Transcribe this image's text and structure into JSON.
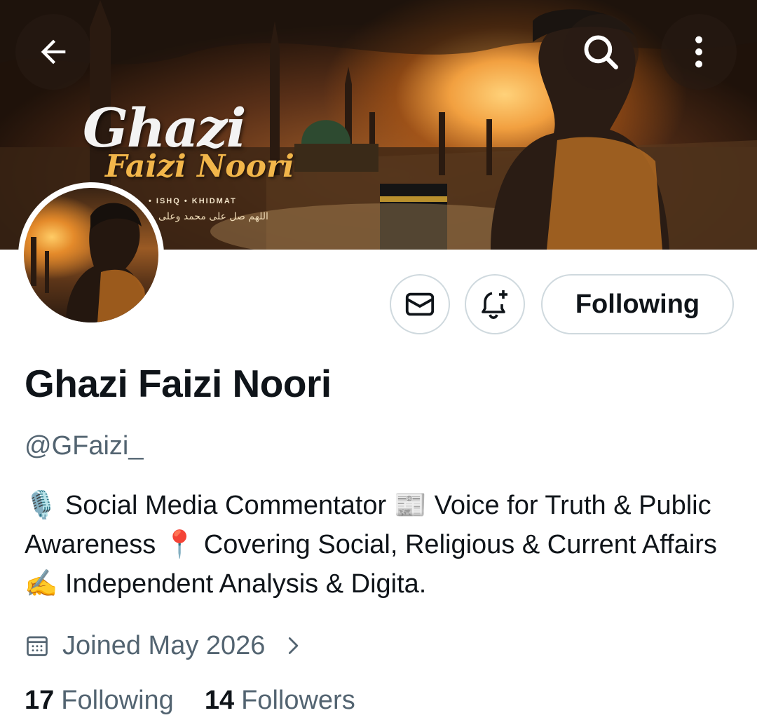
{
  "banner": {
    "title_line1": "Ghazi",
    "title_line2": "Faizi Noori",
    "tagline": "• ISHQ • KHIDMAT",
    "arabic_text": "اللهم صل على محمد وعلى"
  },
  "nav": {
    "back_icon": "arrow-left-icon",
    "search_icon": "search-icon",
    "more_icon": "more-vertical-icon"
  },
  "actions": {
    "message_icon": "mail-icon",
    "notify_icon": "bell-plus-icon",
    "follow_label": "Following"
  },
  "profile": {
    "display_name": "Ghazi Faizi Noori",
    "handle": "@GFaizi_",
    "bio": [
      {
        "emoji": "🎙️",
        "text": " Social Media Commentator "
      },
      {
        "emoji": "📰",
        "text": " Voice for Truth & Public Awareness "
      },
      {
        "emoji": "📍",
        "text": " Covering Social, Religious & Current Affairs "
      },
      {
        "emoji": "✍️",
        "text": " Independent Analysis & Digita."
      }
    ],
    "joined": "Joined May 2026",
    "joined_icon": "calendar-icon"
  },
  "stats": {
    "following_count": "17",
    "following_label": "Following",
    "followers_count": "14",
    "followers_label": "Followers"
  },
  "colors": {
    "text_primary": "#0f1419",
    "text_secondary": "#536471",
    "border": "#cfd9de"
  }
}
